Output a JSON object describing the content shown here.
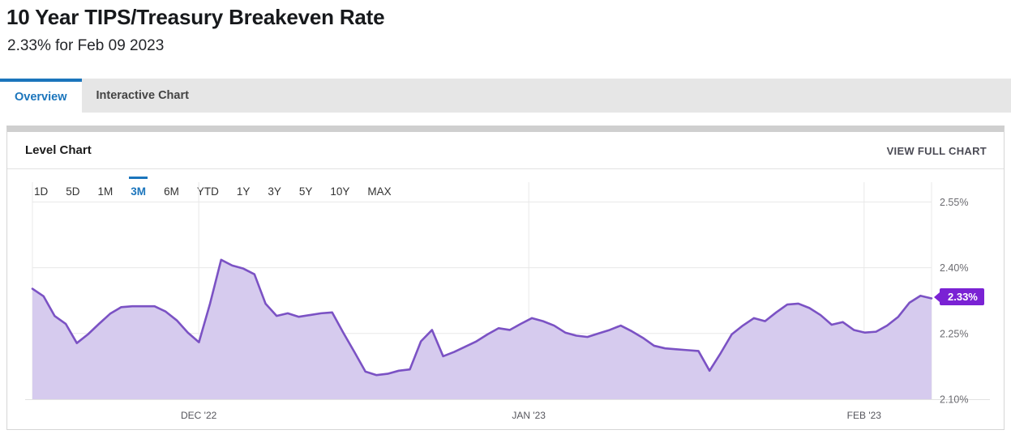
{
  "header": {
    "title": "10 Year TIPS/Treasury Breakeven Rate",
    "subtitle": "2.33% for Feb 09 2023"
  },
  "tabs": [
    {
      "label": "Overview",
      "active": true
    },
    {
      "label": "Interactive Chart",
      "active": false
    }
  ],
  "panel": {
    "title": "Level Chart",
    "view_full_label": "VIEW FULL CHART"
  },
  "ranges": [
    {
      "label": "1D",
      "active": false
    },
    {
      "label": "5D",
      "active": false
    },
    {
      "label": "1M",
      "active": false
    },
    {
      "label": "3M",
      "active": true
    },
    {
      "label": "6M",
      "active": false
    },
    {
      "label": "YTD",
      "active": false
    },
    {
      "label": "1Y",
      "active": false
    },
    {
      "label": "3Y",
      "active": false
    },
    {
      "label": "5Y",
      "active": false
    },
    {
      "label": "10Y",
      "active": false
    },
    {
      "label": "MAX",
      "active": false
    }
  ],
  "colors": {
    "line": "#7b52c4",
    "fill": "#d6cbee",
    "badge": "#7a22d4",
    "accent": "#1b75bc",
    "grid": "#e8e8e8"
  },
  "last_value_badge": "2.33%",
  "chart_data": {
    "type": "area",
    "title": "Level Chart",
    "xlabel": "",
    "ylabel": "",
    "ylim": [
      2.1,
      2.595
    ],
    "yticks": [
      2.55,
      2.4,
      2.25,
      2.1
    ],
    "ytick_labels": [
      "2.55%",
      "2.40%",
      "2.25%",
      "2.10%"
    ],
    "xtick_labels": [
      "DEC '22",
      "JAN '23",
      "FEB '23"
    ],
    "xtick_positions": [
      0.185,
      0.552,
      0.925
    ],
    "grid": true,
    "legend": false,
    "series": [
      {
        "name": "10 Year TIPS/Treasury Breakeven Rate",
        "last_value": 2.33,
        "last_date": "Feb 09 2023",
        "values": [
          2.352,
          2.335,
          2.29,
          2.272,
          2.228,
          2.248,
          2.272,
          2.295,
          2.31,
          2.312,
          2.312,
          2.312,
          2.3,
          2.28,
          2.252,
          2.23,
          2.318,
          2.418,
          2.405,
          2.398,
          2.385,
          2.318,
          2.29,
          2.296,
          2.288,
          2.292,
          2.296,
          2.298,
          2.252,
          2.208,
          2.163,
          2.155,
          2.158,
          2.165,
          2.168,
          2.232,
          2.258,
          2.198,
          2.208,
          2.22,
          2.232,
          2.248,
          2.262,
          2.258,
          2.272,
          2.285,
          2.278,
          2.268,
          2.252,
          2.245,
          2.242,
          2.25,
          2.258,
          2.268,
          2.255,
          2.24,
          2.222,
          2.216,
          2.214,
          2.212,
          2.21,
          2.165,
          2.205,
          2.248,
          2.268,
          2.285,
          2.278,
          2.298,
          2.316,
          2.318,
          2.308,
          2.292,
          2.27,
          2.276,
          2.258,
          2.252,
          2.254,
          2.268,
          2.288,
          2.32,
          2.336,
          2.33
        ]
      }
    ]
  }
}
